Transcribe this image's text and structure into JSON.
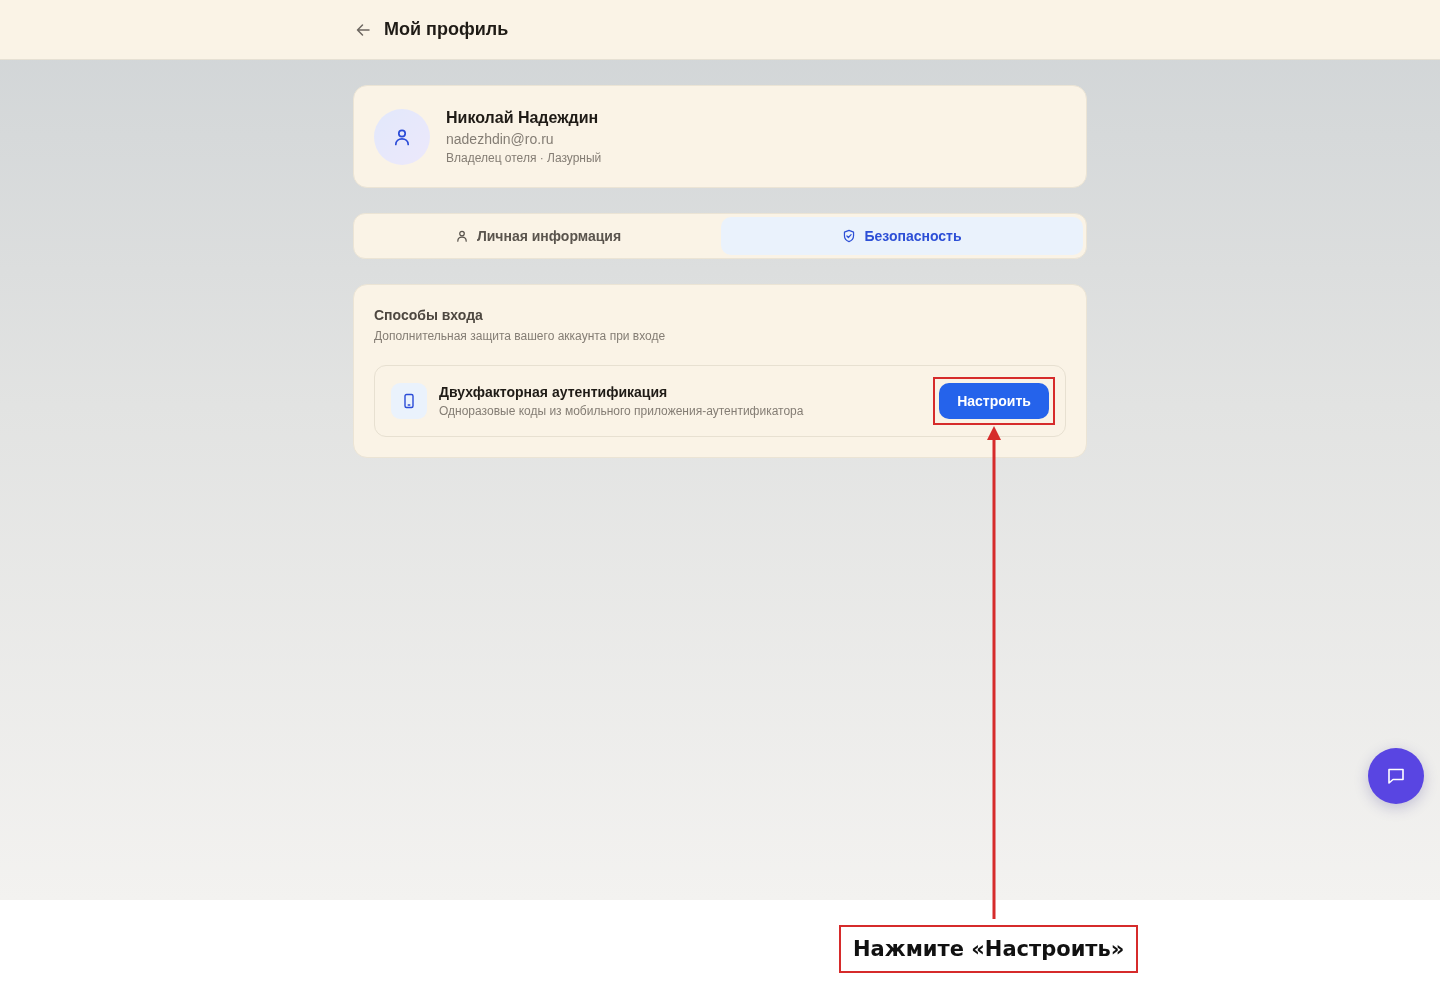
{
  "header": {
    "title": "Мой профиль"
  },
  "profile": {
    "name": "Николай Надеждин",
    "email": "nadezhdin@ro.ru",
    "role": "Владелец отеля · Лазурный"
  },
  "tabs": [
    {
      "label": "Личная информация",
      "selected": false,
      "kind": "person"
    },
    {
      "label": "Безопасность",
      "selected": true,
      "kind": "shield"
    }
  ],
  "login_methods": {
    "title": "Способы входа",
    "subtitle": "Дополнительная защита вашего аккаунта при входе",
    "items": [
      {
        "title": "Двухфакторная аутентификация",
        "description": "Одноразовые коды из мобильного приложения-аутентификатора",
        "button": "Настроить",
        "highlighted": true
      }
    ]
  },
  "annotation": {
    "text": "Нажмите «Настроить»"
  }
}
